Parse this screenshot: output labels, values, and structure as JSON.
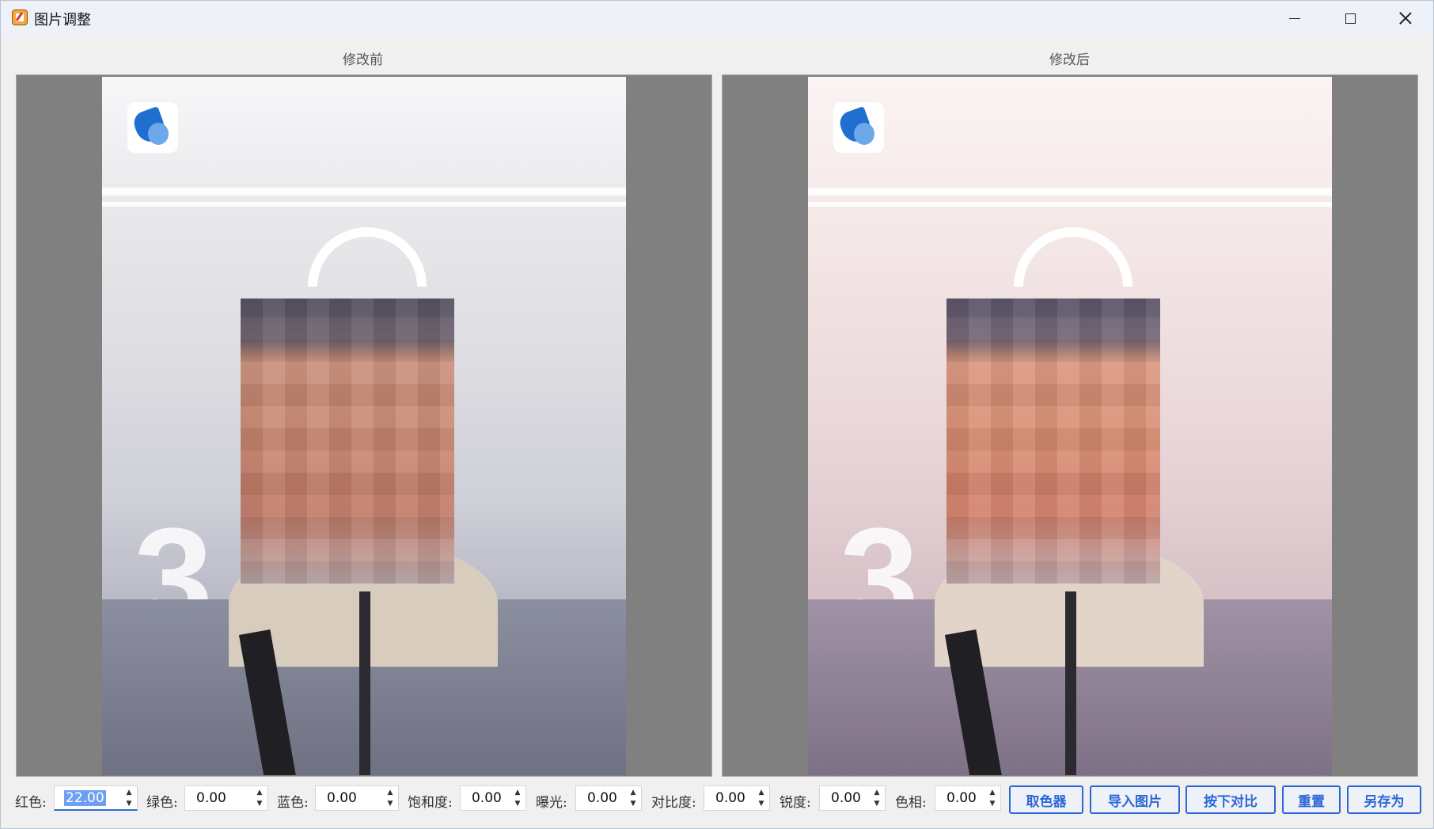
{
  "window": {
    "title": "图片调整"
  },
  "panels": {
    "before_label": "修改前",
    "after_label": "修改后"
  },
  "controls": {
    "red": {
      "label": "红色:",
      "value": "22.00"
    },
    "green": {
      "label": "绿色:",
      "value": "0.00"
    },
    "blue": {
      "label": "蓝色:",
      "value": "0.00"
    },
    "saturation": {
      "label": "饱和度:",
      "value": "0.00"
    },
    "exposure": {
      "label": "曝光:",
      "value": "0.00"
    },
    "contrast": {
      "label": "对比度:",
      "value": "0.00"
    },
    "sharpness": {
      "label": "锐度:",
      "value": "0.00"
    },
    "hue": {
      "label": "色相:",
      "value": "0.00"
    }
  },
  "buttons": {
    "color_picker": "取色器",
    "import_image": "导入图片",
    "hold_compare": "按下对比",
    "reset": "重置",
    "save_as": "另存为"
  },
  "colors": {
    "accent": "#2d67d6",
    "image_background": "#808080"
  }
}
